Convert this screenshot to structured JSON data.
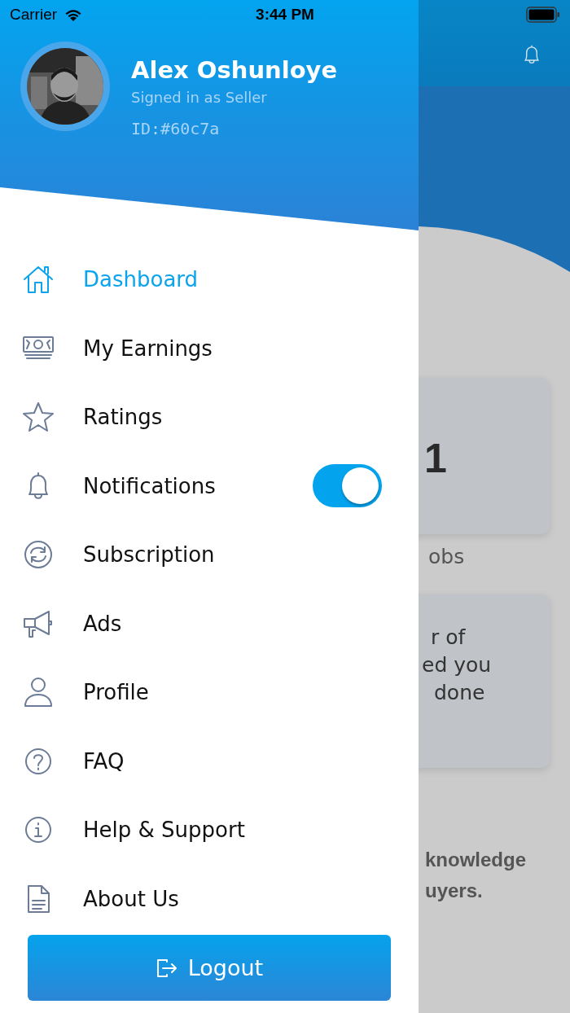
{
  "status_bar": {
    "carrier": "Carrier",
    "time": "3:44 PM"
  },
  "profile": {
    "name": "Alex Oshunloye",
    "role": "Signed in as Seller",
    "id": "ID:#60c7a"
  },
  "menu": [
    {
      "kind": "link",
      "label": "Dashboard",
      "selected": true
    },
    {
      "kind": "link",
      "label": "My Earnings",
      "selected": false
    },
    {
      "kind": "link",
      "label": "Ratings",
      "selected": false
    },
    {
      "kind": "toggle",
      "label": "Notifications",
      "selected": false,
      "on": true
    },
    {
      "kind": "link",
      "label": "Subscription",
      "selected": false
    },
    {
      "kind": "link",
      "label": "Ads",
      "selected": false
    },
    {
      "kind": "link",
      "label": "Profile",
      "selected": false
    },
    {
      "kind": "link",
      "label": "FAQ",
      "selected": false
    },
    {
      "kind": "link",
      "label": "Help & Support",
      "selected": false
    },
    {
      "kind": "link",
      "label": "About Us",
      "selected": false
    }
  ],
  "logout_button": {
    "label": "Logout"
  },
  "background_screen": {
    "stat_value": "1",
    "stat_label": "obs",
    "card_lines": [
      "r of",
      "ed you",
      "done"
    ],
    "note_lines": [
      "knowledge",
      "uyers."
    ]
  }
}
